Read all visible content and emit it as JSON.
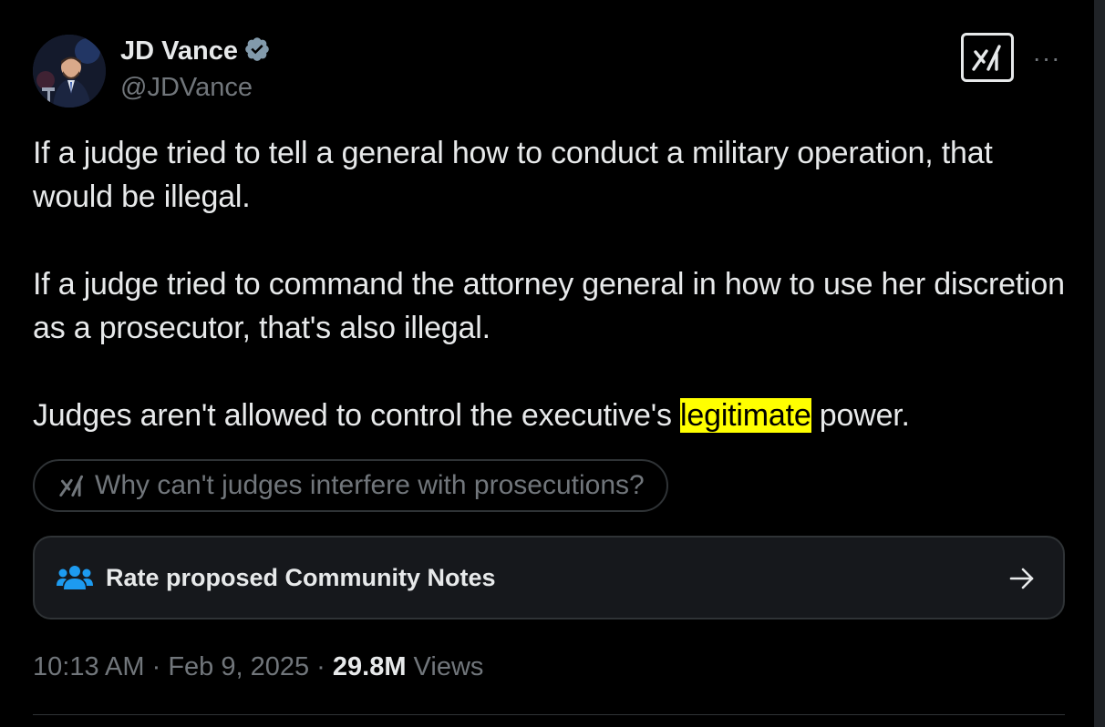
{
  "author": {
    "display_name": "JD Vance",
    "handle": "@JDVance",
    "verified": true
  },
  "header": {
    "grok_icon": "grok-icon",
    "more_icon": "more-horizontal-icon",
    "more_label": "···"
  },
  "tweet": {
    "paragraphs": [
      "If a judge tried to tell a general how to conduct a military operation, that would be illegal.",
      "If a judge tried to command the attorney general in how to use her discretion as a prosecutor, that's also illegal."
    ],
    "last_before": "Judges aren't allowed to control the executive's ",
    "highlighted": "legitimate",
    "last_after": " power."
  },
  "grok_prompt": {
    "text": "Why can't judges interfere with prosecutions?"
  },
  "community_notes": {
    "label": "Rate proposed Community Notes"
  },
  "meta": {
    "time": "10:13 AM",
    "separator": " · ",
    "date": "Feb 9, 2025",
    "views_count": "29.8M",
    "views_label": " Views"
  },
  "colors": {
    "background": "#000000",
    "text": "#e7e9ea",
    "secondary": "#71767b",
    "highlight": "#ffff00",
    "verified": "#829aab",
    "notes_icon": "#1d9bf0"
  }
}
